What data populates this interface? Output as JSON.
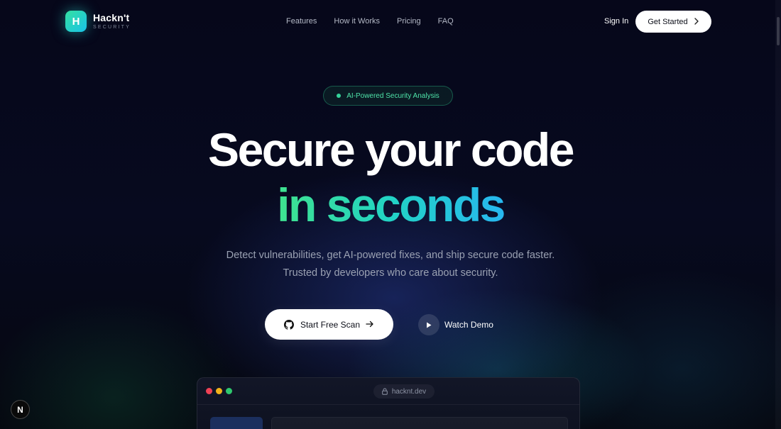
{
  "nav": {
    "logo_letter": "H",
    "brand_name": "Hackn't",
    "brand_sub": "SECURITY",
    "links": [
      "Features",
      "How it Works",
      "Pricing",
      "FAQ"
    ],
    "sign_in": "Sign In",
    "get_started": "Get Started"
  },
  "hero": {
    "badge": "AI-Powered Security Analysis",
    "headline_line1": "Secure your code",
    "headline_line2": "in seconds",
    "subtitle_line1": "Detect vulnerabilities, get AI-powered fixes, and ship secure code faster.",
    "subtitle_line2": "Trusted by developers who care about security.",
    "primary_cta": "Start Free Scan",
    "secondary_cta": "Watch Demo"
  },
  "preview": {
    "url": "hacknt.dev"
  },
  "dev_indicator": {
    "letter": "N"
  },
  "colors": {
    "background": "#05060f",
    "accent_green": "#3fe28f",
    "accent_cyan": "#27b7f0",
    "badge_text": "#4ee3a8"
  },
  "icons": {
    "primary_cta_icon": "github-icon",
    "primary_cta_trailing": "arrow-right-icon",
    "secondary_cta_icon": "play-icon",
    "get_started_trailing": "chevron-right-icon",
    "url_icon": "lock-icon"
  }
}
